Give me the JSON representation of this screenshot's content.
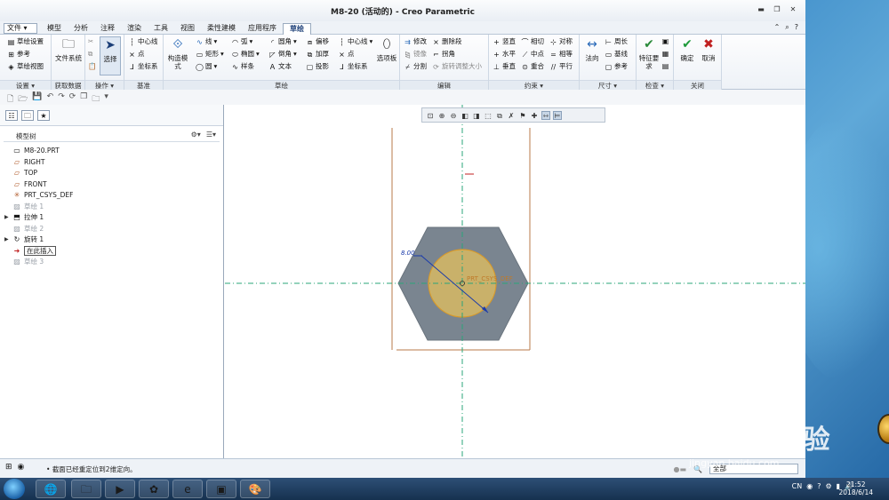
{
  "window": {
    "title": "M8-20 (活动的) - Creo Parametric"
  },
  "menubar": {
    "file": "文件",
    "tabs": [
      "模型",
      "分析",
      "注释",
      "渲染",
      "工具",
      "视图",
      "柔性建模",
      "应用程序",
      "草绘"
    ],
    "active_tab": "草绘"
  },
  "ribbon": {
    "groups": {
      "setup": {
        "label": "设置",
        "items": [
          "草绘设置",
          "参考",
          "草绘视图"
        ]
      },
      "getdata": {
        "label": "获取数据",
        "items": [
          "文件系统"
        ]
      },
      "operations": {
        "label": "操作",
        "items": [
          "选择"
        ]
      },
      "datum": {
        "label": "基准",
        "items": [
          "中心线",
          "点",
          "坐标系"
        ]
      },
      "sketch": {
        "label": "草绘",
        "items": [
          "构造模式",
          "线",
          "矩形",
          "圆",
          "弧",
          "椭圆",
          "样条",
          "圆角",
          "倒角",
          "文本",
          "偏移",
          "加厚",
          "投影",
          "中心线",
          "点",
          "坐标系",
          "选项板"
        ]
      },
      "edit": {
        "label": "编辑",
        "items": [
          "修改",
          "删除段",
          "镜像",
          "拐角",
          "分割",
          "旋转调整大小"
        ]
      },
      "constrain": {
        "label": "约束",
        "items": [
          "竖直",
          "相切",
          "对称",
          "水平",
          "中点",
          "相等",
          "垂直",
          "重合",
          "平行"
        ]
      },
      "dimension": {
        "label": "尺寸",
        "items": [
          "法向",
          "周长",
          "基线",
          "参考"
        ]
      },
      "inspect": {
        "label": "检查",
        "items": [
          "特征要求"
        ]
      },
      "close": {
        "label": "关闭",
        "items": [
          "确定",
          "取消"
        ]
      }
    }
  },
  "model_tree": {
    "header": "模型树",
    "items": [
      {
        "label": "M8-20.PRT",
        "icon": "part-icon",
        "dim": false,
        "expandable": false
      },
      {
        "label": "RIGHT",
        "icon": "datum-plane-icon",
        "dim": false,
        "expandable": false
      },
      {
        "label": "TOP",
        "icon": "datum-plane-icon",
        "dim": false,
        "expandable": false
      },
      {
        "label": "FRONT",
        "icon": "datum-plane-icon",
        "dim": false,
        "expandable": false
      },
      {
        "label": "PRT_CSYS_DEF",
        "icon": "csys-icon",
        "dim": false,
        "expandable": false
      },
      {
        "label": "草绘 1",
        "icon": "sketch-icon",
        "dim": true,
        "expandable": false
      },
      {
        "label": "拉伸 1",
        "icon": "extrude-icon",
        "dim": false,
        "expandable": true
      },
      {
        "label": "草绘 2",
        "icon": "sketch-icon",
        "dim": true,
        "expandable": false
      },
      {
        "label": "旋转 1",
        "icon": "revolve-icon",
        "dim": false,
        "expandable": true
      },
      {
        "label": "在此插入",
        "icon": "insert-arrow-icon",
        "dim": false,
        "expandable": false,
        "boxed": true
      },
      {
        "label": "草绘 3",
        "icon": "sketch-icon",
        "dim": true,
        "expandable": false
      }
    ]
  },
  "canvas": {
    "dimension_label": "8.00",
    "csys_label": "PRT_CSYS_DEF",
    "colors": {
      "hexagon": "#7a8590",
      "circle_fill": "#c9b16a",
      "circle_stroke": "#d89a2a",
      "centerline": "#2aa57a",
      "dimension": "#1a3aaa",
      "border": "#b87a4a"
    }
  },
  "statusbar": {
    "message": "截面已经重定位到2维定向。",
    "filter": "全部"
  },
  "taskbar": {
    "lang": "CN",
    "time": "21:52",
    "date": "2018/6/14"
  },
  "watermark": {
    "brand": "Baidu 经验",
    "url": "jingyan.baidu.com"
  }
}
